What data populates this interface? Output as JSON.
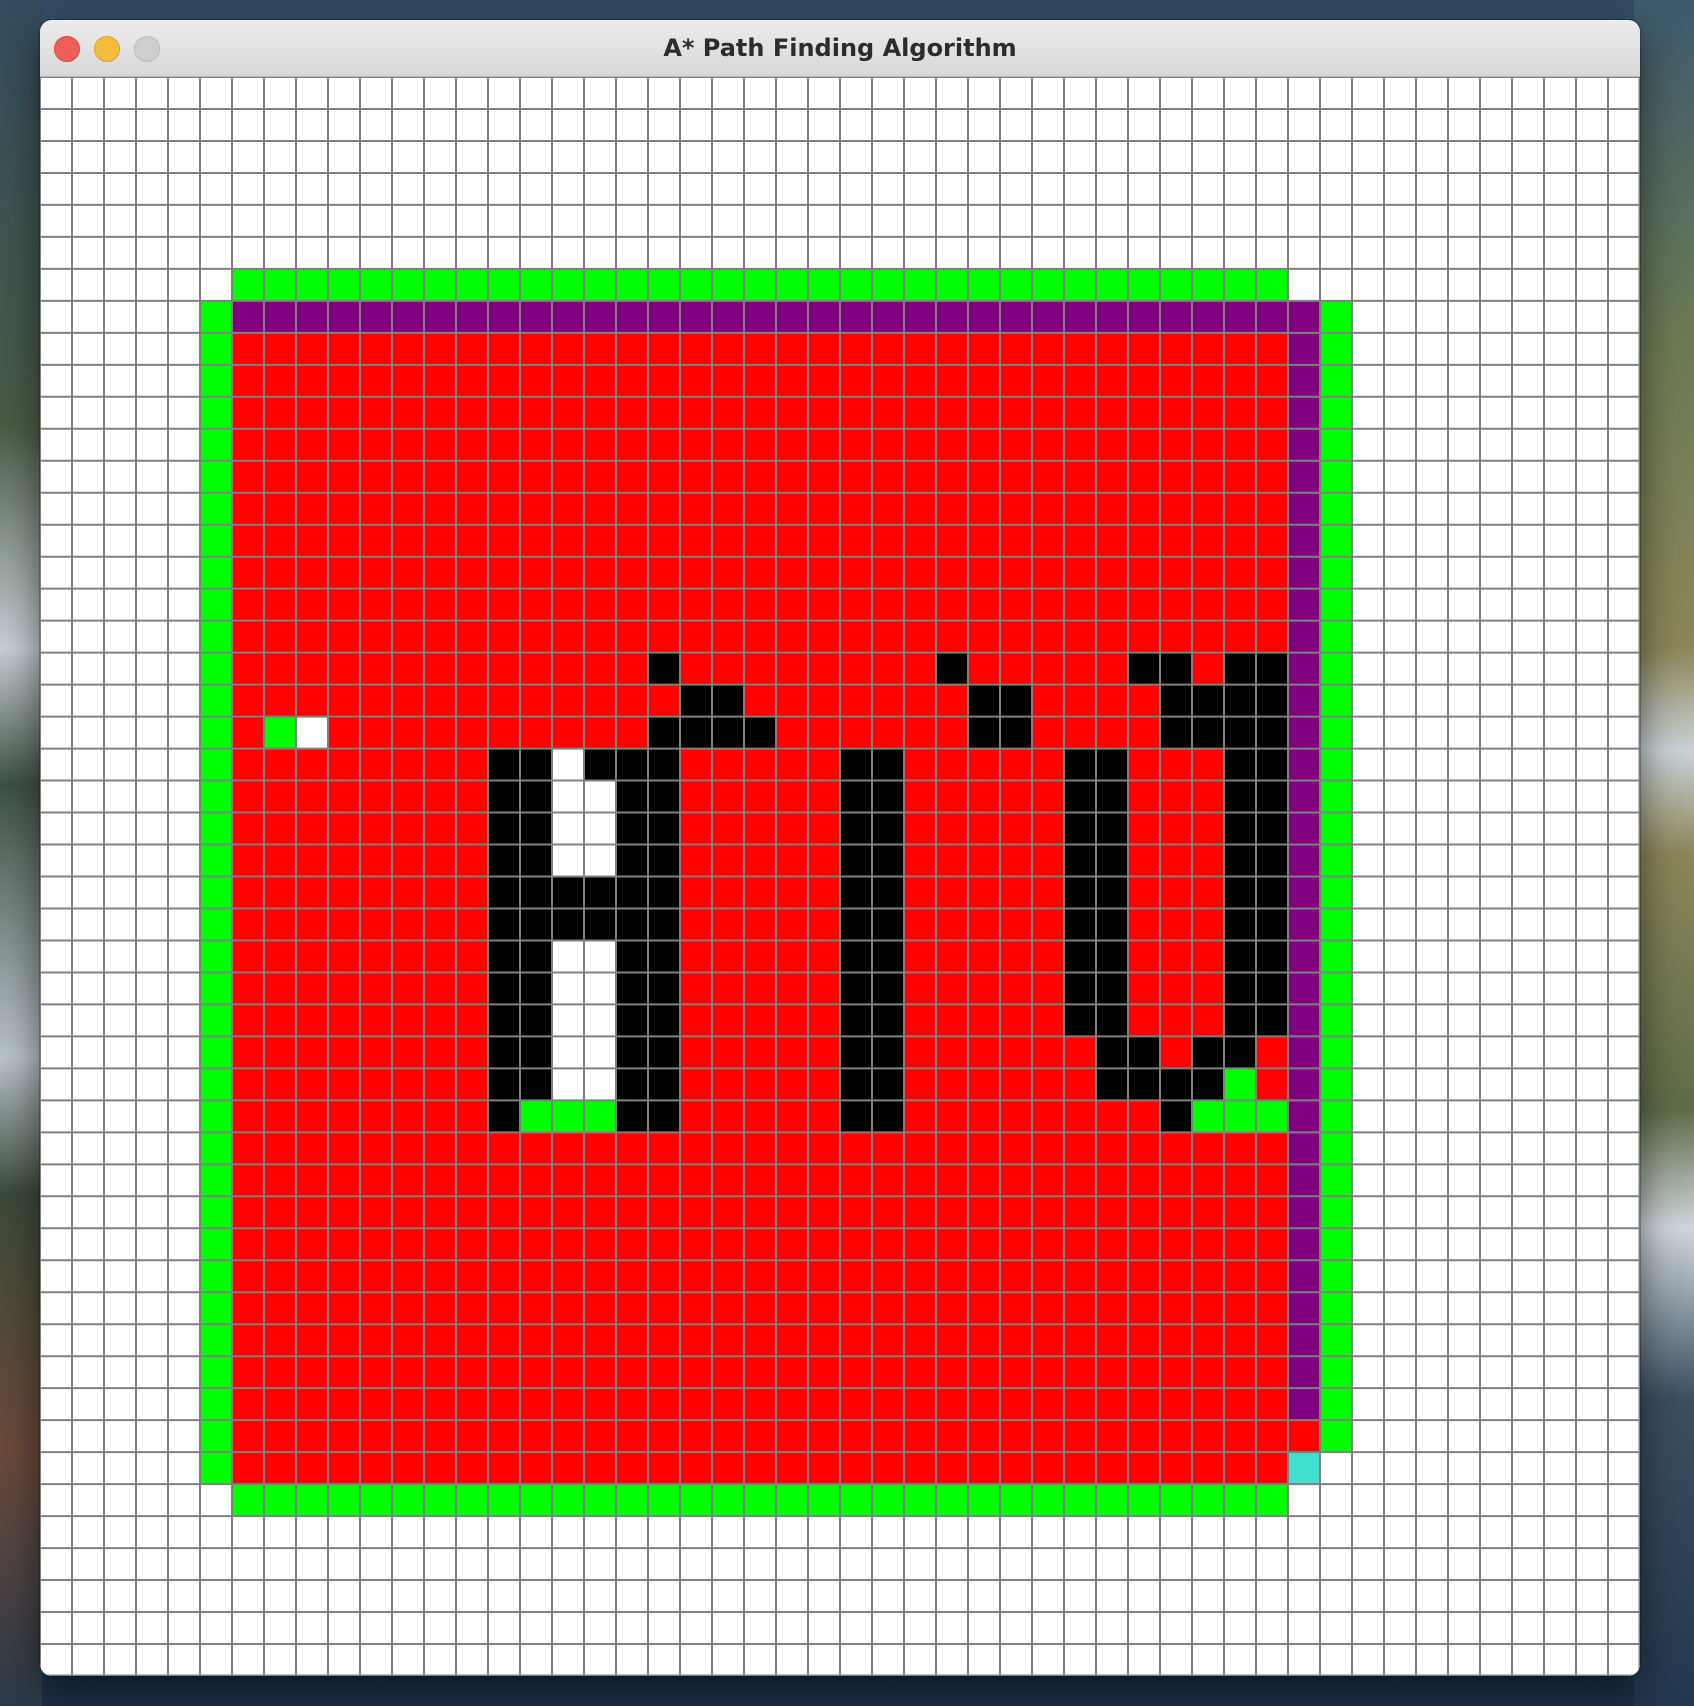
{
  "window": {
    "title": "A* Path Finding Algorithm",
    "buttons": [
      {
        "name": "close",
        "color": "#ee5f57"
      },
      {
        "name": "minimize",
        "color": "#f6bd3b"
      },
      {
        "name": "zoom",
        "color": "#cfcfcf"
      }
    ]
  },
  "grid": {
    "rows": 50,
    "cols": 50,
    "colors": {
      "empty": "#ffffff",
      "grid_line": "#808080",
      "closed": "#ff0000",
      "open": "#00ff00",
      "barrier": "#000000",
      "path": "#800080",
      "end": "#40e0d0"
    },
    "legend": {
      "o": "open",
      "c": "closed",
      "p": "path",
      "#": "barrier",
      "e": "end",
      ".": "empty"
    },
    "cells": [
      "..................................................",
      "..................................................",
      "..................................................",
      "..................................................",
      "..................................................",
      "..................................................",
      "......ooooooooooooooooooooooooooooooooo...........",
      ".....oppppppppppppppppppppppppppppppppppo.........",
      ".....occcccccccccccccccccccccccccccccccpo.........",
      ".....occcccccccccccccccccccccccccccccccpo.........",
      ".....occcccccccccccccccccccccccccccccccpo.........",
      ".....occcccccccccccccccccccccccccccccccpo.........",
      ".....occcccccccccccccccccccccccccccccccpo.........",
      ".....occcccccccccccccccccccccccccccccccpo.........",
      ".....occcccccccccccccccccccccccccccccccpo.........",
      ".....occcccccccccccccccccccccccccccccccpo.........",
      ".....occcccccccccccccccccccccccccccccccpo.........",
      ".....occcccccccccccccccccccccccccccccccpo.........",
      ".....occccccccccccc#cccccccc#ccccc##cccc##ccpo.........",
      ".....occcccccccccccc##ccccccc##ccccc##cccc##ccpo.........",
      ".....oconcccccccccc####cccccc##ccccc##cccc##ccpo.........",
      ".....occcccccc##.###ccccc##ccccc##cccc##ccpo.........",
      ".....occcccccc##..##ccccc##ccccc##cccc##ccpo.........",
      ".....occcccccc##..##ccccc##ccccc##cccc##ccpo.........",
      ".....occcccccc##..##ccccc##ccccc##cccc##ccpo.........",
      ".....occcccccc######ccccc##ccccc##cccc##ccpo.........",
      ".....occcccccc######ccccc##ccccc##cccc##ccpo.........",
      ".....occcccccc##..##ccccc##ccccc##cccc##ccpo.........",
      ".....occcccccc##..##ccccc##ccccc##cccc##ccpo.........",
      ".....occcccccc##..##ccccc##ccccc##cccc##ccpo.........",
      ".....occcccccc##..##ccccc##cccccc##c##cccpo.........",
      ".....occcccccc##..##ccccc##cccccc####occcpo.........",
      ".....occcccccc#ooo##ccccc##cccccccc#ooocccpo.........",
      ".....occcccccccccccccccccccccccccccccccpo.........",
      ".....occcccccccccccccccccccccccccccccccpo.........",
      ".....occcccccccccccccccccccccccccccccccpo.........",
      ".....occcccccccccccccccccccccccccccccccpo.........",
      ".....occcccccccccccccccccccccccccccccccpo.........",
      ".....occcccccccccccccccccccccccccccccccpo.........",
      ".....occcccccccccccccccccccccccccccccccpo.........",
      ".....occcccccccccccccccccccccccccccccccpo.........",
      ".....occcccccccccccccccccccccccccccccccpo.........",
      ".....occcccccccccccccccccccccccccccccccco.........",
      ".....occcccccccccccccccccccccccccccccccce..........",
      "......ooooooooooooooooooooooooooooooooo...........",
      "..................................................",
      "..................................................",
      "..................................................",
      "..................................................",
      ".................................................."
    ]
  }
}
